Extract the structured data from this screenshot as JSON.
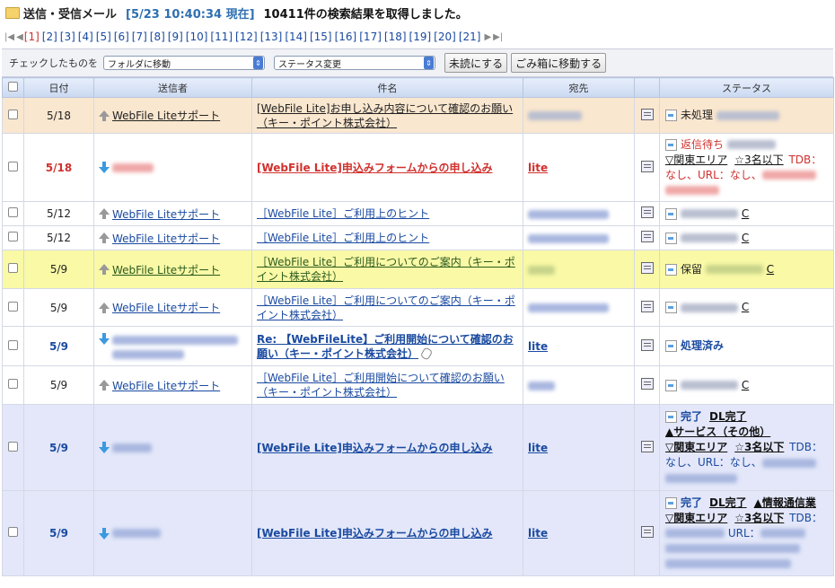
{
  "header": {
    "title": "送信・受信メール",
    "timestamp": "[5/23 10:40:34 現在]",
    "result": "10411件の検索結果を取得しました。"
  },
  "pager": {
    "pages": [
      "[1]",
      "[2]",
      "[3]",
      "[4]",
      "[5]",
      "[6]",
      "[7]",
      "[8]",
      "[9]",
      "[10]",
      "[11]",
      "[12]",
      "[13]",
      "[14]",
      "[15]",
      "[16]",
      "[17]",
      "[18]",
      "[19]",
      "[20]",
      "[21]"
    ]
  },
  "actions": {
    "label": "チェックしたものを",
    "folder_select": "フォルダに移動",
    "status_select": "ステータス変更",
    "unread_button": "未読にする",
    "trash_button": "ごみ箱に移動する"
  },
  "table": {
    "columns": [
      "日付",
      "送信者",
      "件名",
      "宛先",
      "ステータス"
    ]
  },
  "rows": [
    {
      "date": "5/18",
      "sender": "WebFile Liteサポート",
      "subject": "[WebFile Lite]お申し込み内容について確認のお願い（キー・ポイント株式会社）",
      "to": "",
      "status": "未処理"
    },
    {
      "date": "5/18",
      "sender": "",
      "subject": "[WebFile Lite]申込みフォームからの申し込み",
      "to": "lite",
      "status": "返信待ち",
      "area": "▽関東エリア",
      "people": "☆3名以下",
      "tdb": "TDB：",
      "tdb2": "なし、URL：なし、"
    },
    {
      "date": "5/12",
      "sender": "WebFile Liteサポート",
      "subject": "［WebFile Lite］ご利用上のヒント",
      "to": "",
      "status_suffix": "C"
    },
    {
      "date": "5/12",
      "sender": "WebFile Liteサポート",
      "subject": "［WebFile Lite］ご利用上のヒント",
      "to": "",
      "status_suffix": "C"
    },
    {
      "date": "5/9",
      "sender": "WebFile Liteサポート",
      "subject": "［WebFile Lite］ご利用についてのご案内（キー・ポイント株式会社）",
      "to": "",
      "status": "保留",
      "status_suffix": "C"
    },
    {
      "date": "5/9",
      "sender": "WebFile Liteサポート",
      "subject": "［WebFile Lite］ご利用についてのご案内（キー・ポイント株式会社）",
      "to": "",
      "status_suffix": "C"
    },
    {
      "date": "5/9",
      "sender": "",
      "subject": "Re: 【WebFileLite】ご利用開始について確認のお願い（キー・ポイント株式会社）",
      "to": "lite",
      "status": "処理済み"
    },
    {
      "date": "5/9",
      "sender": "WebFile Liteサポート",
      "subject": "［WebFile Lite］ご利用開始について確認のお願い（キー・ポイント株式会社）",
      "to": "",
      "status_suffix": "C"
    },
    {
      "date": "5/9",
      "sender": "",
      "subject": "[WebFile Lite]申込みフォームからの申し込み",
      "to": "lite",
      "status": "完了",
      "dl": "DL完了",
      "service": "▲サービス（その他）",
      "area": "▽関東エリア",
      "people": "☆3名以下",
      "tdb": "TDB：",
      "tdb2": "なし、URL：なし、"
    },
    {
      "date": "5/9",
      "sender": "",
      "subject": "[WebFile Lite]申込みフォームからの申し込み",
      "to": "lite",
      "status": "完了",
      "dl": "DL完了",
      "service": "▲情報通信業",
      "area": "▽関東エリア",
      "people": "☆3名以下",
      "tdb": "TDB：",
      "url": "URL："
    }
  ]
}
